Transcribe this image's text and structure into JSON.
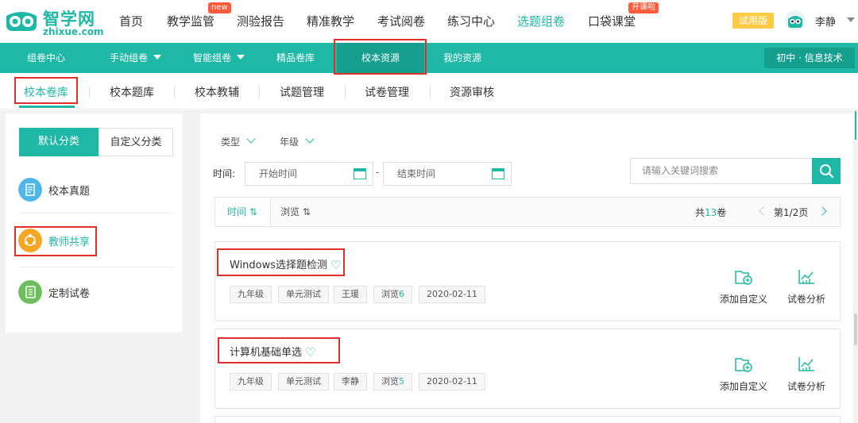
{
  "brand": {
    "name_cn": "智学网",
    "name_en": "zhixue.com"
  },
  "topnav": {
    "items": [
      {
        "label": "首页"
      },
      {
        "label": "教学监管"
      },
      {
        "label": "测验报告"
      },
      {
        "label": "精准教学"
      },
      {
        "label": "考试阅卷"
      },
      {
        "label": "练习中心"
      },
      {
        "label": "选题组卷"
      },
      {
        "label": "口袋课堂"
      }
    ],
    "tag_new": "new",
    "tag_class": "开课啦",
    "trial": "试用版",
    "username": "李静"
  },
  "subnav": {
    "items": [
      {
        "label": "组卷中心"
      },
      {
        "label": "手动组卷"
      },
      {
        "label": "智能组卷"
      },
      {
        "label": "精品卷库"
      },
      {
        "label": "校本资源"
      },
      {
        "label": "我的资源"
      }
    ],
    "subject": "初中 · 信息技术"
  },
  "tabs": [
    {
      "label": "校本卷库"
    },
    {
      "label": "校本题库"
    },
    {
      "label": "校本教辅"
    },
    {
      "label": "试题管理"
    },
    {
      "label": "试卷管理"
    },
    {
      "label": "资源审核"
    }
  ],
  "sidebar": {
    "seg_default": "默认分类",
    "seg_custom": "自定义分类",
    "categories": [
      {
        "label": "校本真题"
      },
      {
        "label": "教师共享"
      },
      {
        "label": "定制试卷"
      }
    ]
  },
  "filters": {
    "type": "类型",
    "grade": "年级",
    "time_label": "时间:",
    "start_placeholder": "开始时间",
    "end_placeholder": "结束时间",
    "dash": "-",
    "search_placeholder": "请输入关键词搜索"
  },
  "sort": {
    "time": "时间",
    "views": "浏览",
    "total_prefix": "共",
    "total_count": "13",
    "total_suffix": "卷",
    "page": "第1/2页"
  },
  "papers": [
    {
      "title": "Windows选择题检测",
      "grade": "九年级",
      "type": "单元测试",
      "author": "王瑗",
      "views_label": "浏览",
      "views": "6",
      "date": "2020-02-11"
    },
    {
      "title": "计算机基础单选",
      "grade": "九年级",
      "type": "单元测试",
      "author": "李静",
      "views_label": "浏览",
      "views": "5",
      "date": "2020-02-11"
    }
  ],
  "actions": {
    "add_custom": "添加自定义",
    "analysis": "试卷分析"
  },
  "colors": {
    "brand": "#1fb8a6",
    "brand_dark": "#149f8f",
    "highlight": "#e0302c",
    "tag": "#ff5b3a",
    "trial": "#ffcb45"
  }
}
